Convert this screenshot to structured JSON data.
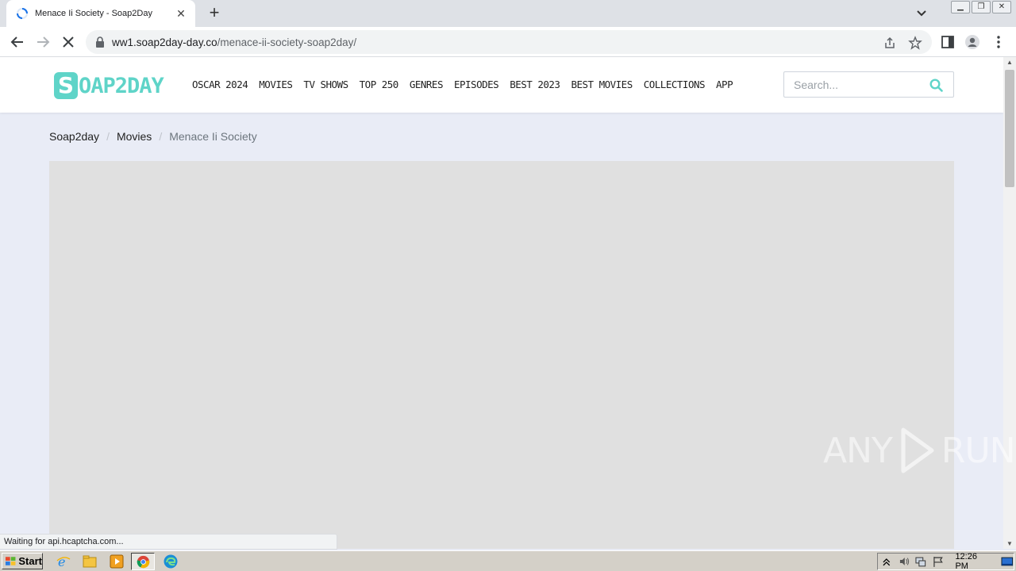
{
  "browser": {
    "tab_title": "Menace Ii Society - Soap2Day",
    "url_host": "ww1.soap2day-day.co",
    "url_path": "/menace-ii-society-soap2day/",
    "status_text": "Waiting for api.hcaptcha.com..."
  },
  "site": {
    "logo_s": "S",
    "logo_rest": "OAP2DAY",
    "menu": [
      "OSCAR 2024",
      "MOVIES",
      "TV SHOWS",
      "TOP 250",
      "GENRES",
      "EPISODES",
      "BEST 2023",
      "BEST MOVIES",
      "COLLECTIONS",
      "APP"
    ],
    "search_placeholder": "Search...",
    "breadcrumb": {
      "home": "Soap2day",
      "section": "Movies",
      "current": "Menace Ii Society",
      "separator": "/"
    },
    "accent_color": "#5fd4c8"
  },
  "watermark": {
    "left": "ANY",
    "right": "RUN"
  },
  "taskbar": {
    "start_label": "Start",
    "clock": "12:26 PM"
  }
}
